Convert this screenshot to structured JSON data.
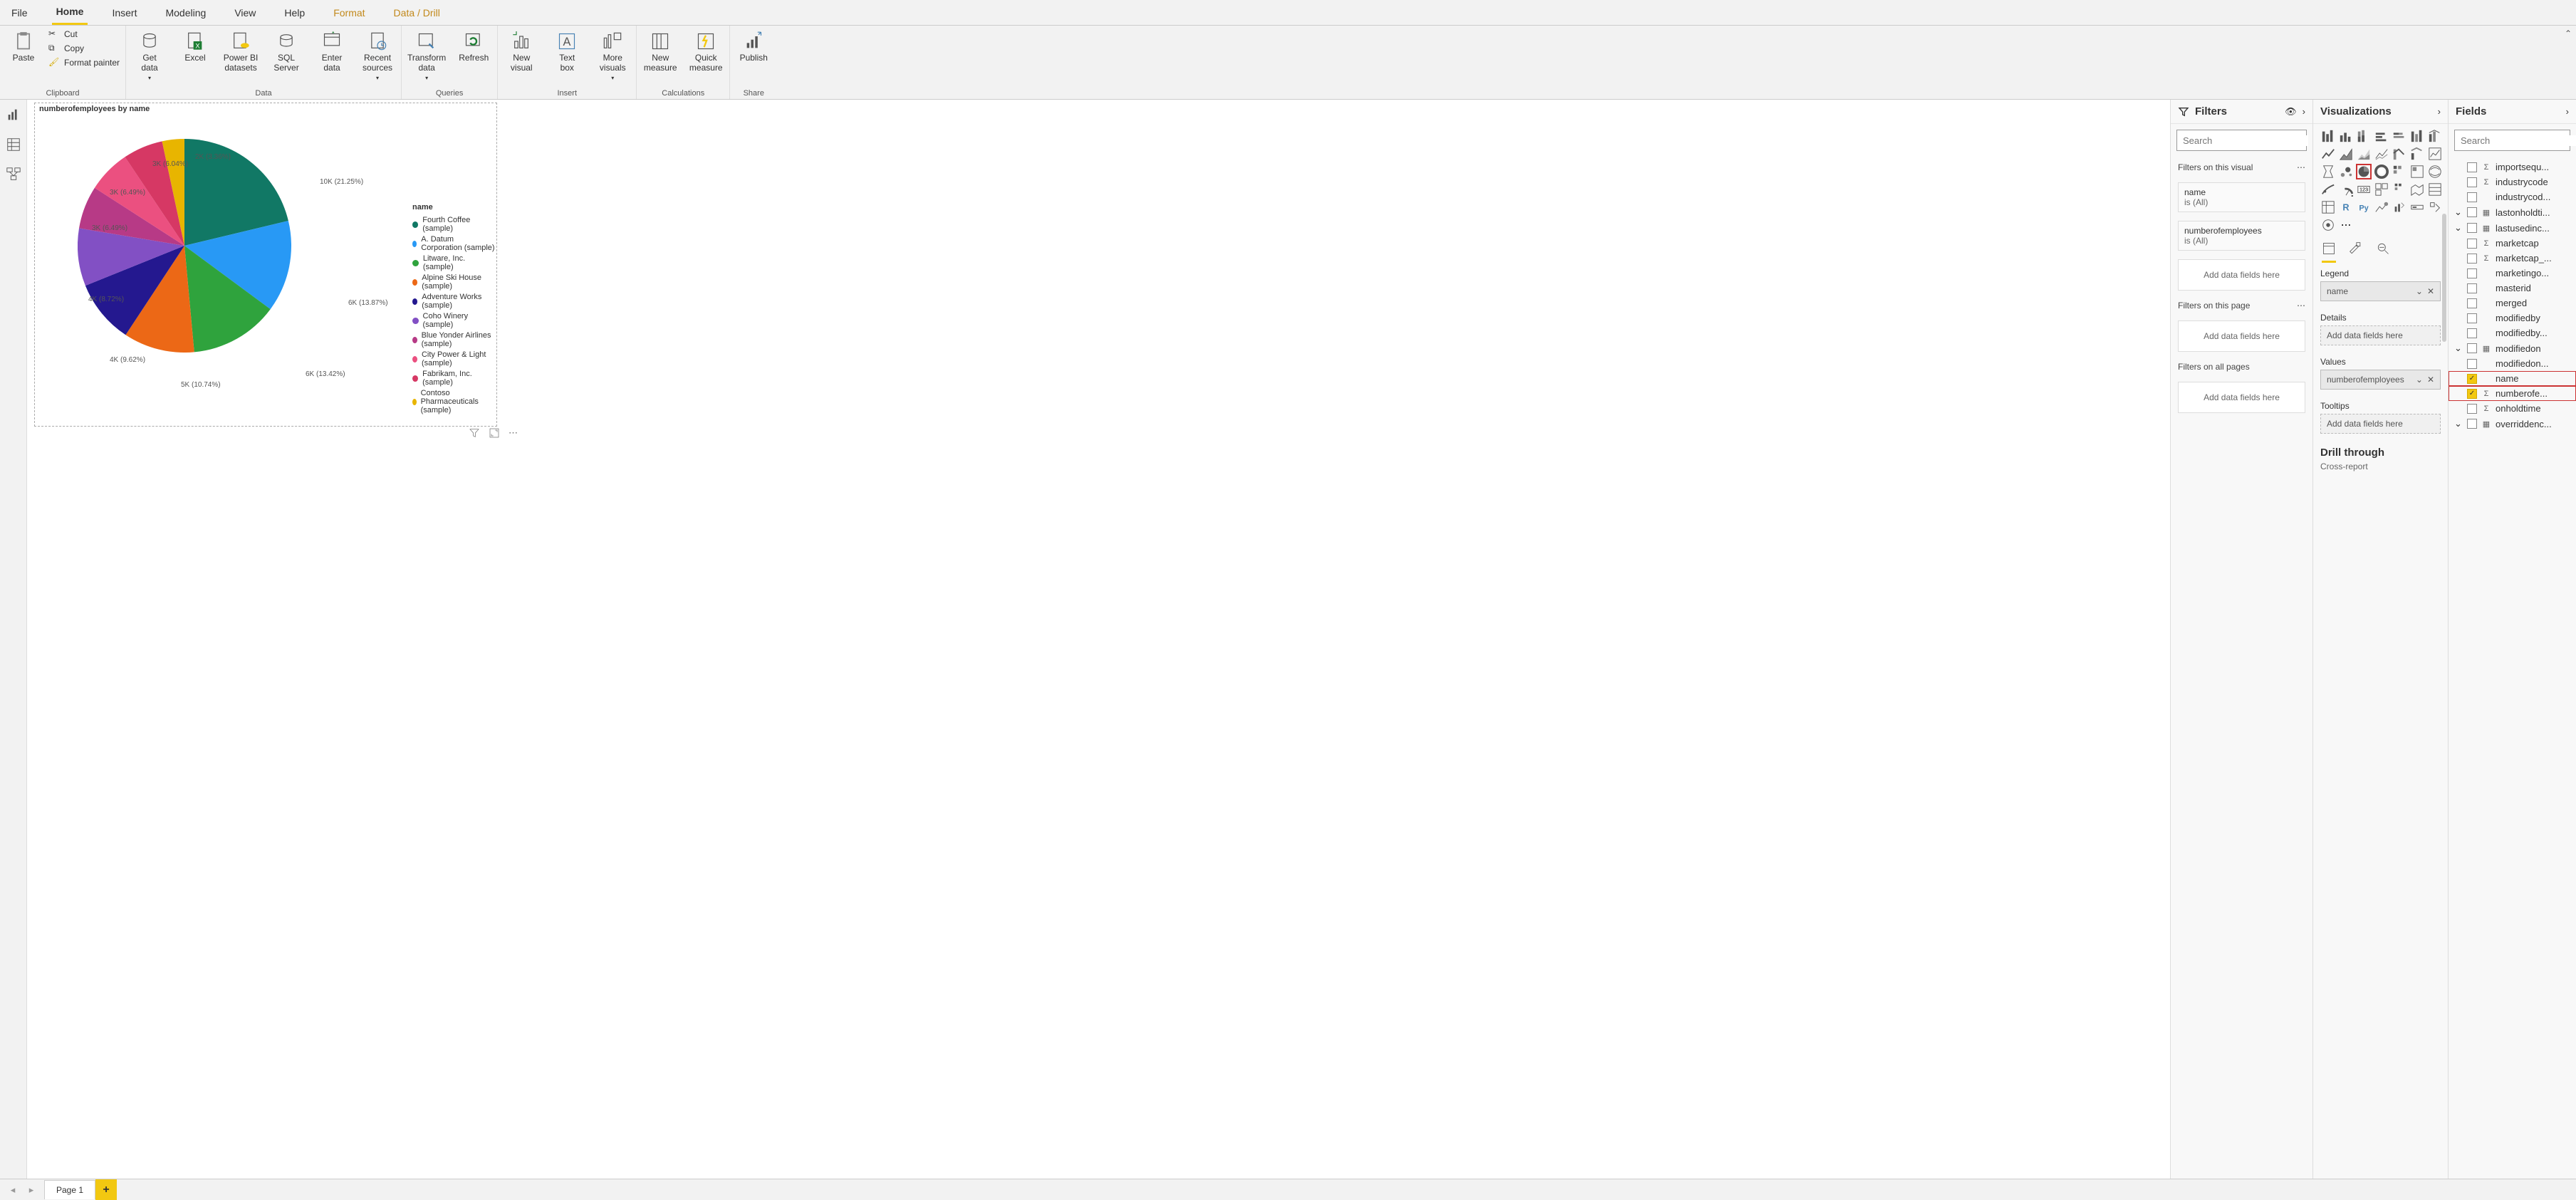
{
  "menu": {
    "items": [
      {
        "label": "File"
      },
      {
        "label": "Home",
        "active": true
      },
      {
        "label": "Insert"
      },
      {
        "label": "Modeling"
      },
      {
        "label": "View"
      },
      {
        "label": "Help"
      },
      {
        "label": "Format",
        "highlighted": true
      },
      {
        "label": "Data / Drill",
        "highlighted": true
      }
    ]
  },
  "ribbon": {
    "clipboard": {
      "paste": "Paste",
      "cut": "Cut",
      "copy": "Copy",
      "format_painter": "Format painter",
      "group": "Clipboard"
    },
    "data": {
      "get_data": "Get\ndata",
      "excel": "Excel",
      "pbi": "Power BI\ndatasets",
      "sql": "SQL\nServer",
      "enter": "Enter\ndata",
      "recent": "Recent\nsources",
      "group": "Data"
    },
    "queries": {
      "transform": "Transform\ndata",
      "refresh": "Refresh",
      "group": "Queries"
    },
    "insert": {
      "visual": "New\nvisual",
      "text": "Text\nbox",
      "more": "More\nvisuals",
      "group": "Insert"
    },
    "calc": {
      "measure": "New\nmeasure",
      "quick": "Quick\nmeasure",
      "group": "Calculations"
    },
    "share": {
      "publish": "Publish",
      "group": "Share"
    }
  },
  "visual": {
    "title": "numberofemployees by name",
    "legend_title": "name"
  },
  "chart_data": {
    "type": "pie",
    "title": "numberofemployees by name",
    "series": [
      {
        "name": "Fourth Coffee (sample)",
        "label": "10K (21.25%)",
        "value": 10000,
        "pct": 21.25,
        "color": "#117865"
      },
      {
        "name": "A. Datum Corporation (sample)",
        "label": "6K (13.87%)",
        "value": 6000,
        "pct": 13.87,
        "color": "#2899f5"
      },
      {
        "name": "Litware, Inc. (sample)",
        "label": "6K (13.42%)",
        "value": 6000,
        "pct": 13.42,
        "color": "#2fa33d"
      },
      {
        "name": "Alpine Ski House (sample)",
        "label": "5K (10.74%)",
        "value": 5000,
        "pct": 10.74,
        "color": "#ec6816"
      },
      {
        "name": "Adventure Works (sample)",
        "label": "4K (9.62%)",
        "value": 4000,
        "pct": 9.62,
        "color": "#24188f"
      },
      {
        "name": "Coho Winery (sample)",
        "label": "4K (8.72%)",
        "value": 4000,
        "pct": 8.72,
        "color": "#8250c4"
      },
      {
        "name": "Blue Yonder Airlines (sample)",
        "label": "3K (6.49%)",
        "value": 3000,
        "pct": 6.49,
        "color": "#b73a86"
      },
      {
        "name": "City Power & Light (sample)",
        "label": "3K (6.49%)",
        "value": 3000,
        "pct": 6.49,
        "color": "#eb5080"
      },
      {
        "name": "Fabrikam, Inc. (sample)",
        "label": "3K (6.04%)",
        "value": 3000,
        "pct": 6.04,
        "color": "#d63864"
      },
      {
        "name": "Contoso Pharmaceuticals (sample)",
        "label": "2K (3.36%)",
        "value": 2000,
        "pct": 3.36,
        "color": "#e8b500"
      }
    ]
  },
  "filters": {
    "title": "Filters",
    "search_placeholder": "Search",
    "on_visual": "Filters on this visual",
    "cards": [
      {
        "name": "name",
        "value": "is (All)"
      },
      {
        "name": "numberofemployees",
        "value": "is (All)"
      }
    ],
    "add_fields": "Add data fields here",
    "on_page": "Filters on this page",
    "on_all": "Filters on all pages"
  },
  "viz": {
    "title": "Visualizations",
    "legend": "Legend",
    "legend_field": "name",
    "details": "Details",
    "details_placeholder": "Add data fields here",
    "values": "Values",
    "values_field": "numberofemployees",
    "tooltips": "Tooltips",
    "tooltips_placeholder": "Add data fields here",
    "drillthrough": "Drill through",
    "cross": "Cross-report"
  },
  "fields": {
    "title": "Fields",
    "search_placeholder": "Search",
    "items": [
      {
        "name": "importsequ...",
        "sigma": true,
        "caret": false
      },
      {
        "name": "industrycode",
        "sigma": true,
        "caret": false
      },
      {
        "name": "industrycod...",
        "caret": false
      },
      {
        "name": "lastonholdti...",
        "caret": true,
        "table": true
      },
      {
        "name": "lastusedinc...",
        "caret": true,
        "table": true
      },
      {
        "name": "marketcap",
        "sigma": true
      },
      {
        "name": "marketcap_...",
        "sigma": true
      },
      {
        "name": "marketingo..."
      },
      {
        "name": "masterid"
      },
      {
        "name": "merged"
      },
      {
        "name": "modifiedby"
      },
      {
        "name": "modifiedby..."
      },
      {
        "name": "modifiedon",
        "caret": true,
        "table": true
      },
      {
        "name": "modifiedon..."
      },
      {
        "name": "name",
        "checked": true,
        "highlight": true
      },
      {
        "name": "numberofe...",
        "checked": true,
        "sigma": true,
        "highlight": true
      },
      {
        "name": "onholdtime",
        "sigma": true
      },
      {
        "name": "overriddenc...",
        "caret": true,
        "table": true
      }
    ]
  },
  "footer": {
    "page": "Page 1"
  }
}
